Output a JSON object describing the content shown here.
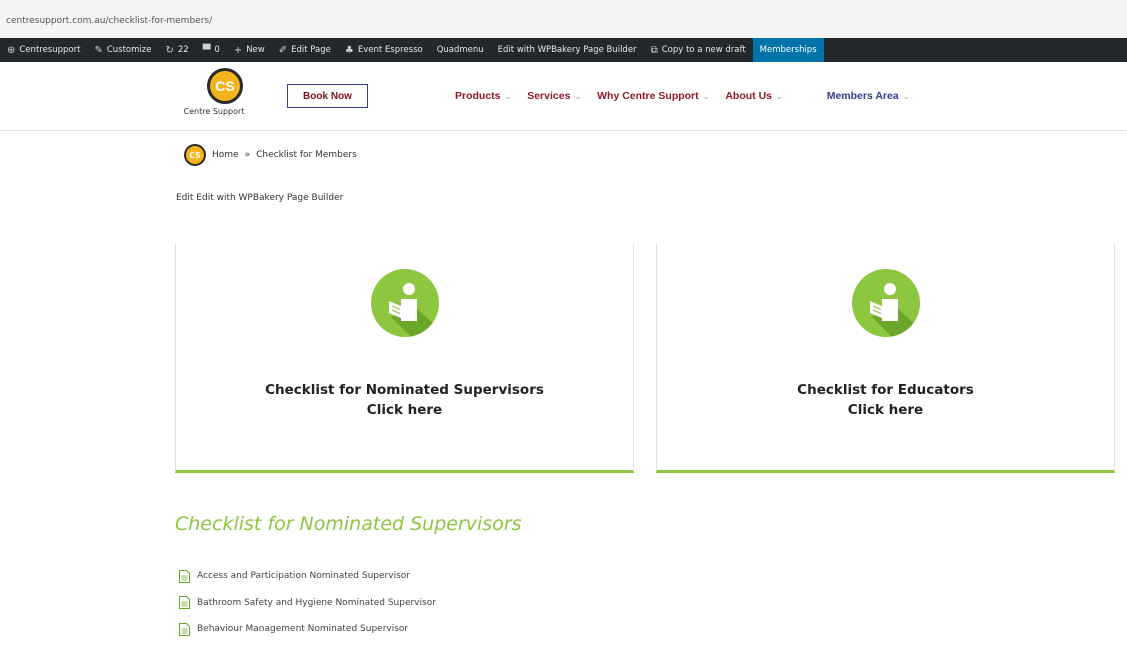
{
  "browser": {
    "url": "centresupport.com.au/checklist-for-members/"
  },
  "admin_bar": {
    "items": [
      {
        "label": "Centresupport",
        "icon": "wordpress-icon"
      },
      {
        "label": "Customize",
        "icon": "brush-icon"
      },
      {
        "label": "22",
        "icon": "updates-icon"
      },
      {
        "label": "0",
        "icon": "comment-icon"
      },
      {
        "label": "New",
        "icon": "plus-icon"
      },
      {
        "label": "Edit Page",
        "icon": "pencil-icon"
      },
      {
        "label": "Event Espresso",
        "icon": "ticket-icon"
      },
      {
        "label": "Quadmenu",
        "icon": ""
      },
      {
        "label": "Edit with WPBakery Page Builder",
        "icon": ""
      },
      {
        "label": "Copy to a new draft",
        "icon": "copy-icon"
      },
      {
        "label": "Memberships",
        "icon": "",
        "highlight": true
      }
    ]
  },
  "header": {
    "logo_initials": "CS",
    "logo_text": "Centre Support",
    "book_label": "Book Now",
    "nav": [
      {
        "label": "Products"
      },
      {
        "label": "Services"
      },
      {
        "label": "Why Centre Support"
      },
      {
        "label": "About Us"
      },
      {
        "label": "Members Area"
      }
    ],
    "colors": {
      "nav": "#8b1a2b",
      "members": "#2c3f8f",
      "logo": "#f2b31c"
    }
  },
  "breadcrumb": {
    "logo_initials": "CS",
    "home": "Home",
    "separator": "»",
    "current": "Checklist for Members"
  },
  "edit_links": {
    "text": "Edit Edit with WPBakery Page Builder"
  },
  "cards": [
    {
      "title": "Checklist for Nominated Supervisors",
      "subtitle": "Click here",
      "icon": "reading-person-icon"
    },
    {
      "title": "Checklist for Educators",
      "subtitle": "Click here",
      "icon": "reading-person-icon"
    }
  ],
  "section": {
    "heading": "Checklist for Nominated Supervisors",
    "accent": "#8dc63f",
    "documents": [
      {
        "label": "Access and Participation Nominated Supervisor"
      },
      {
        "label": "Bathroom Safety and Hygiene Nominated Supervisor"
      },
      {
        "label": "Behaviour Management Nominated Supervisor"
      }
    ]
  }
}
